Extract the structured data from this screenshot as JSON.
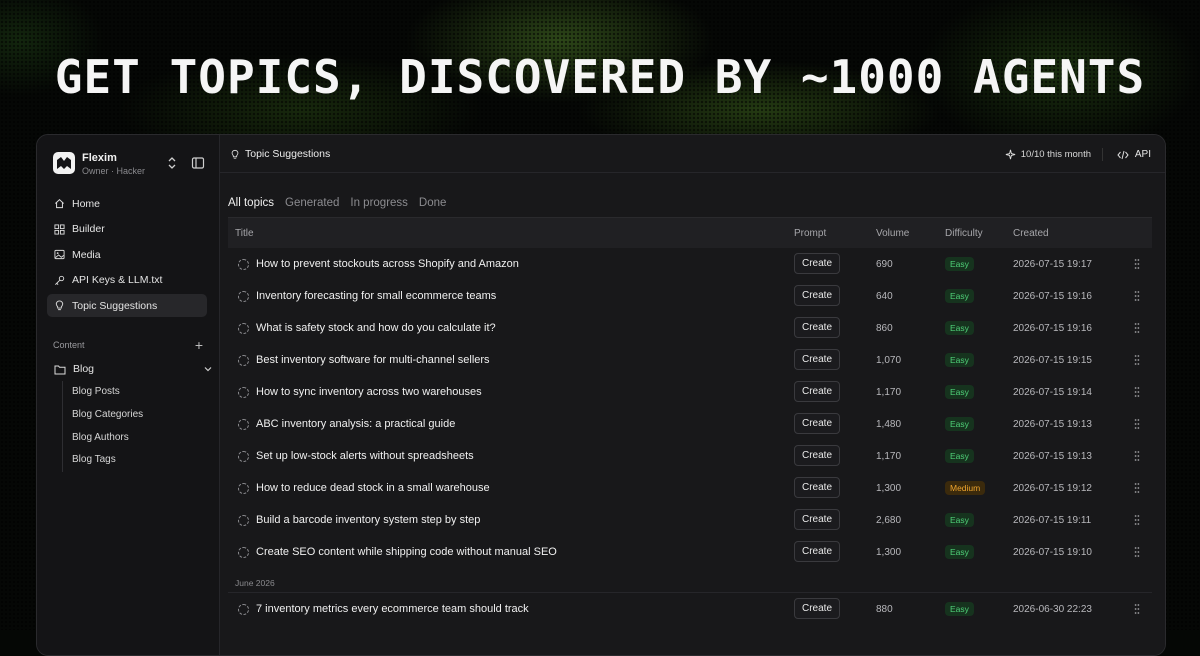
{
  "headline": "GET TOPICS, DISCOVERED BY ~1000 AGENTS",
  "workspace": {
    "name": "Flexim",
    "subtitle": "Owner · Hacker"
  },
  "nav": [
    {
      "label": "Home",
      "icon": "home-icon"
    },
    {
      "label": "Builder",
      "icon": "grid-icon"
    },
    {
      "label": "Media",
      "icon": "image-icon"
    },
    {
      "label": "API Keys & LLM.txt",
      "icon": "key-icon"
    },
    {
      "label": "Topic Suggestions",
      "icon": "lightbulb-icon",
      "active": true
    }
  ],
  "content_section": {
    "label": "Content",
    "blog": {
      "label": "Blog",
      "items": [
        "Blog Posts",
        "Blog Categories",
        "Blog Authors",
        "Blog Tags"
      ]
    }
  },
  "topbar": {
    "title": "Topic Suggestions",
    "usage": "10/10 this month",
    "api_label": "API"
  },
  "tabs": [
    {
      "label": "All topics",
      "active": true
    },
    {
      "label": "Generated"
    },
    {
      "label": "In progress"
    },
    {
      "label": "Done"
    }
  ],
  "table": {
    "columns": {
      "title": "Title",
      "prompt": "Prompt",
      "volume": "Volume",
      "difficulty": "Difficulty",
      "created": "Created"
    },
    "prompt_button": "Create",
    "rows": [
      {
        "title": "How to prevent stockouts across Shopify and Amazon",
        "volume": "690",
        "difficulty": "Easy",
        "created": "2026-07-15 19:17"
      },
      {
        "title": "Inventory forecasting for small ecommerce teams",
        "volume": "640",
        "difficulty": "Easy",
        "created": "2026-07-15 19:16"
      },
      {
        "title": "What is safety stock and how do you calculate it?",
        "volume": "860",
        "difficulty": "Easy",
        "created": "2026-07-15 19:16"
      },
      {
        "title": "Best inventory software for multi-channel sellers",
        "volume": "1,070",
        "difficulty": "Easy",
        "created": "2026-07-15 19:15"
      },
      {
        "title": "How to sync inventory across two warehouses",
        "volume": "1,170",
        "difficulty": "Easy",
        "created": "2026-07-15 19:14"
      },
      {
        "title": "ABC inventory analysis: a practical guide",
        "volume": "1,480",
        "difficulty": "Easy",
        "created": "2026-07-15 19:13"
      },
      {
        "title": "Set up low-stock alerts without spreadsheets",
        "volume": "1,170",
        "difficulty": "Easy",
        "created": "2026-07-15 19:13"
      },
      {
        "title": "How to reduce dead stock in a small warehouse",
        "volume": "1,300",
        "difficulty": "Medium",
        "created": "2026-07-15 19:12"
      },
      {
        "title": "Build a barcode inventory system step by step",
        "volume": "2,680",
        "difficulty": "Easy",
        "created": "2026-07-15 19:11"
      },
      {
        "title": "Create SEO content while shipping code without manual SEO",
        "volume": "1,300",
        "difficulty": "Easy",
        "created": "2026-07-15 19:10"
      }
    ],
    "group_label": "June 2026",
    "group_rows": [
      {
        "title": "7 inventory metrics every ecommerce team should track",
        "volume": "880",
        "difficulty": "Easy",
        "created": "2026-06-30 22:23"
      }
    ]
  },
  "colors": {
    "easy": "#4fd078",
    "medium": "#f0a52d",
    "accent_glow": "#7cc43c"
  }
}
